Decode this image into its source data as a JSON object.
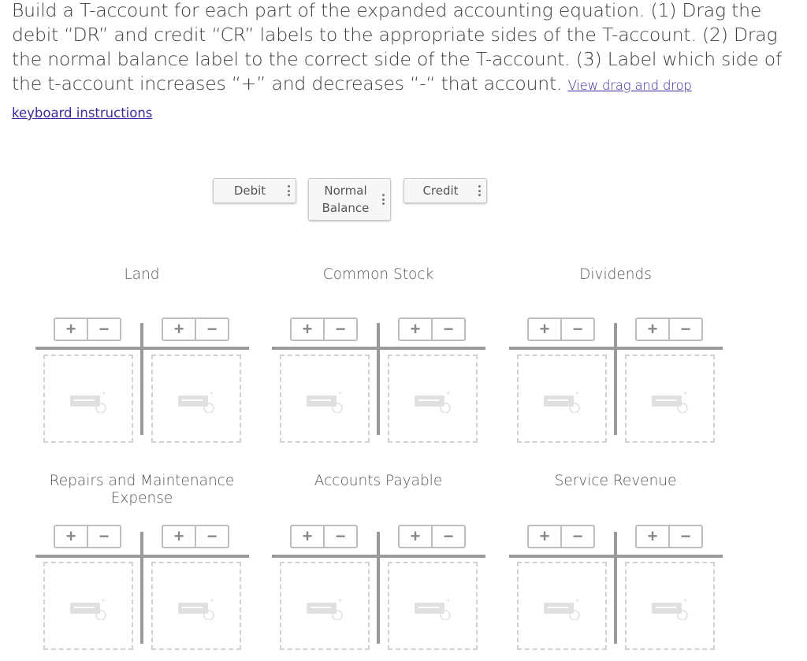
{
  "instructions": {
    "text": "Build a T-account for each part of the expanded accounting equation. (1) Drag the debit “DR” and credit “CR” labels to the appropriate sides of the T-account. (2) Drag the normal balance label to the correct side of the T-account. (3) Label which side of the t-account increases “+” and decreases “-“ that account.",
    "link_part1": "View drag and drop",
    "link_part2": "keyboard instructions"
  },
  "chips": {
    "debit": "Debit",
    "normal_line1": "Normal",
    "normal_line2": "Balance",
    "credit": "Credit"
  },
  "toggle": {
    "plus": "+",
    "minus": "−"
  },
  "icons": {
    "handle": "drag-handle-icon",
    "drop": "drop-target-icon"
  },
  "accounts": [
    {
      "name": "Land"
    },
    {
      "name": "Common Stock"
    },
    {
      "name": "Dividends"
    },
    {
      "name": "Repairs and Maintenance Expense"
    },
    {
      "name": "Accounts Payable"
    },
    {
      "name": "Service Revenue"
    }
  ]
}
